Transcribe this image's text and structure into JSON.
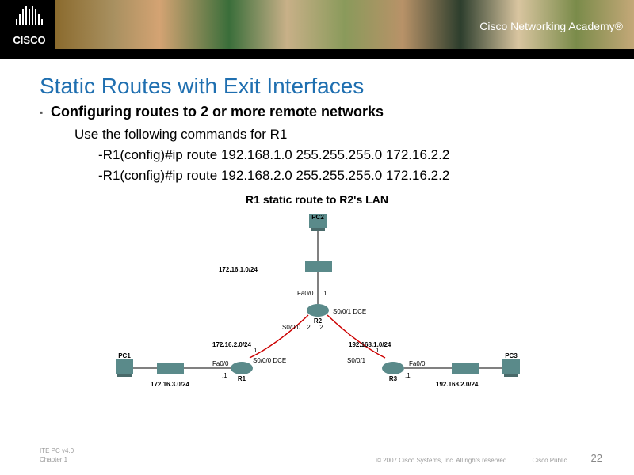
{
  "header": {
    "logo_text": "CISCO",
    "academy": "Cisco Networking Academy®"
  },
  "title": "Static Routes with Exit Interfaces",
  "subheading": "Configuring routes to 2 or more remote networks",
  "instruction": "Use the following commands for R1",
  "cmd1": "-R1(config)#ip route 192.168.1.0 255.255.255.0 172.16.2.2",
  "cmd2": "-R1(config)#ip route 192.168.2.0 255.255.255.0 172.16.2.2",
  "diagram": {
    "title": "R1 static route to R2's LAN",
    "hosts": {
      "pc1": "PC1",
      "pc2": "PC2",
      "pc3": "PC3"
    },
    "routers": {
      "r1": "R1",
      "r2": "R2",
      "r3": "R3"
    },
    "interfaces": {
      "fa00_a": "Fa0/0",
      "fa00_b": "Fa0/0",
      "fa00_c": "Fa0/0",
      "fa00_d": "Fa0/0",
      "s000": "S0/0/0",
      "s000dce": "S0/0/0\nDCE",
      "s001": "S0/0/1",
      "s001dce": "S0/0/1\nDCE"
    },
    "oct": {
      "d1": ".1",
      "d2": ".2"
    },
    "nets": {
      "n1": "172.16.3.0/24",
      "n2": "172.16.2.0/24",
      "n3": "172.16.1.0/24",
      "n4": "192.168.1.0/24",
      "n5": "192.168.2.0/24"
    }
  },
  "footer": {
    "left1": "ITE PC v4.0",
    "left2": "Chapter 1",
    "copyright": "© 2007 Cisco Systems, Inc. All rights reserved.",
    "public": "Cisco Public",
    "page": "22"
  }
}
